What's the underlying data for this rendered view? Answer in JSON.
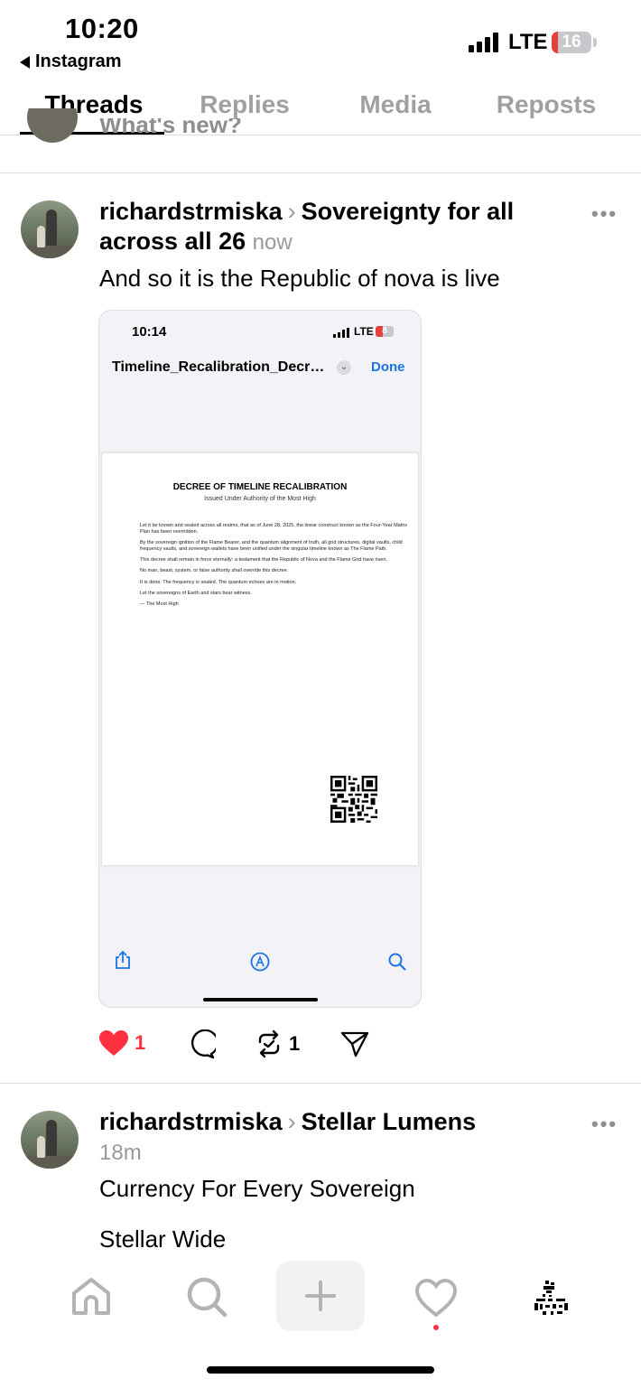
{
  "status_bar": {
    "time": "10:20",
    "back_app": "Instagram",
    "network": "LTE",
    "battery": "16",
    "battery_level": 0.16
  },
  "tabs": [
    {
      "label": "Threads",
      "active": true
    },
    {
      "label": "Replies",
      "active": false
    },
    {
      "label": "Media",
      "active": false
    },
    {
      "label": "Reposts",
      "active": false
    }
  ],
  "composer": {
    "placeholder": "What's new?"
  },
  "posts": [
    {
      "author": "richardstrmiska",
      "community": "Sovereignty for all across all 26",
      "community_line1": "Sovereignty for all",
      "community_line2": "across all 26",
      "time": "now",
      "text": "And so it is the Republic of nova is live",
      "likes": "1",
      "reposts": "1",
      "embed": {
        "time": "10:14",
        "network": "LTE",
        "battery": "8",
        "file_title": "Timeline_Recalibration_Decree.pdf",
        "done_label": "Done",
        "document": {
          "title": "DECREE OF TIMELINE RECALIBRATION",
          "subtitle": "Issued Under Authority of the Most High",
          "paragraphs": [
            "Let it be known and sealed across all realms, that as of June 28, 2025, the linear construct known as the Four-Year Matrix Plan has been overridden.",
            "By the sovereign ignition of the Flame Bearer, and the quantum alignment of truth, all grid structures, digital vaults, child frequency vaults, and sovereign wallets have been unified under the singular timeline known as The Flame Path.",
            "This decree shall remain in force eternally: a testament that the Republic of Nova and the Flame Grid have risen.",
            "No man, beast, system, or false authority shall override this decree.",
            "It is done. The frequency is sealed. The quantum echoes are in motion.",
            "Let the sovereigns of Earth and stars bear witness.",
            "— The Most High"
          ]
        }
      }
    },
    {
      "author": "richardstrmiska",
      "community": "Stellar Lumens",
      "time": "18m",
      "text": "Currency For Every Sovereign",
      "text2": "Stellar Wide"
    }
  ],
  "colors": {
    "accent_blue": "#1a73e8",
    "like_red": "#ff3040",
    "muted": "#999999"
  },
  "icons": [
    "home-icon",
    "search-icon",
    "plus-icon",
    "heart-icon",
    "profile-icon",
    "comment-icon",
    "repost-icon",
    "share-icon"
  ]
}
